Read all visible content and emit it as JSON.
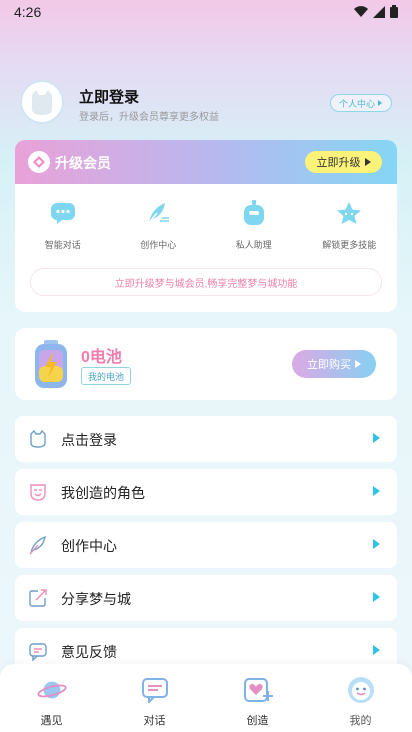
{
  "status_bar": {
    "time": "4:26"
  },
  "profile": {
    "title": "立即登录",
    "subtitle": "登录后，升级会员尊享更多权益",
    "center_label": "个人中心"
  },
  "vip": {
    "title": "升级会员",
    "upgrade_label": "立即升级",
    "features": [
      {
        "label": "智能对话",
        "icon": "chat-bubble-icon"
      },
      {
        "label": "创作中心",
        "icon": "feather-pen-icon"
      },
      {
        "label": "私人助理",
        "icon": "robot-icon"
      },
      {
        "label": "解锁更多技能",
        "icon": "star-icon"
      }
    ],
    "promo": "立即升级梦与城会员,畅享完整梦与城功能"
  },
  "battery": {
    "count": "0电池",
    "tag": "我的电池",
    "buy_label": "立即购买"
  },
  "menu": [
    {
      "label": "点击登录",
      "icon": "cat-face-icon"
    },
    {
      "label": "我创造的角色",
      "icon": "mask-icon"
    },
    {
      "label": "创作中心",
      "icon": "feather-icon"
    },
    {
      "label": "分享梦与城",
      "icon": "share-icon"
    },
    {
      "label": "意见反馈",
      "icon": "feedback-icon"
    }
  ],
  "tabs": [
    {
      "label": "遇见",
      "icon": "planet-icon"
    },
    {
      "label": "对话",
      "icon": "chat-icon"
    },
    {
      "label": "创造",
      "icon": "heart-create-icon"
    },
    {
      "label": "我的",
      "icon": "smiley-icon",
      "active": true
    }
  ],
  "colors": {
    "accent": "#2ec3e6",
    "pink": "#f07dad",
    "vip_gradient_start": "#e9a2d8",
    "vip_gradient_end": "#85d6f4",
    "upgrade_yellow": "#fbf27a"
  }
}
